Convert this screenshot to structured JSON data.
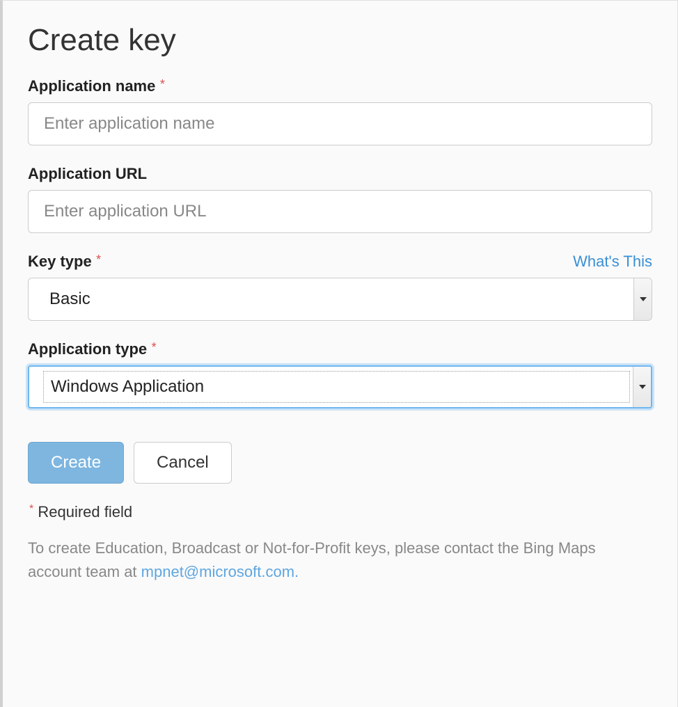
{
  "page": {
    "title": "Create key"
  },
  "form": {
    "app_name": {
      "label": "Application name",
      "required": true,
      "placeholder": "Enter application name",
      "value": ""
    },
    "app_url": {
      "label": "Application URL",
      "required": false,
      "placeholder": "Enter application URL",
      "value": ""
    },
    "key_type": {
      "label": "Key type",
      "required": true,
      "whats_this": "What's This",
      "selected": "Basic"
    },
    "app_type": {
      "label": "Application type",
      "required": true,
      "selected": "Windows Application"
    }
  },
  "buttons": {
    "create": "Create",
    "cancel": "Cancel"
  },
  "footnote": {
    "required_field": "Required field"
  },
  "helper": {
    "prefix": "To create Education, Broadcast or Not-for-Profit keys, please contact the Bing Maps account team at ",
    "email": "mpnet@microsoft.com.",
    "required_marker": "*"
  }
}
